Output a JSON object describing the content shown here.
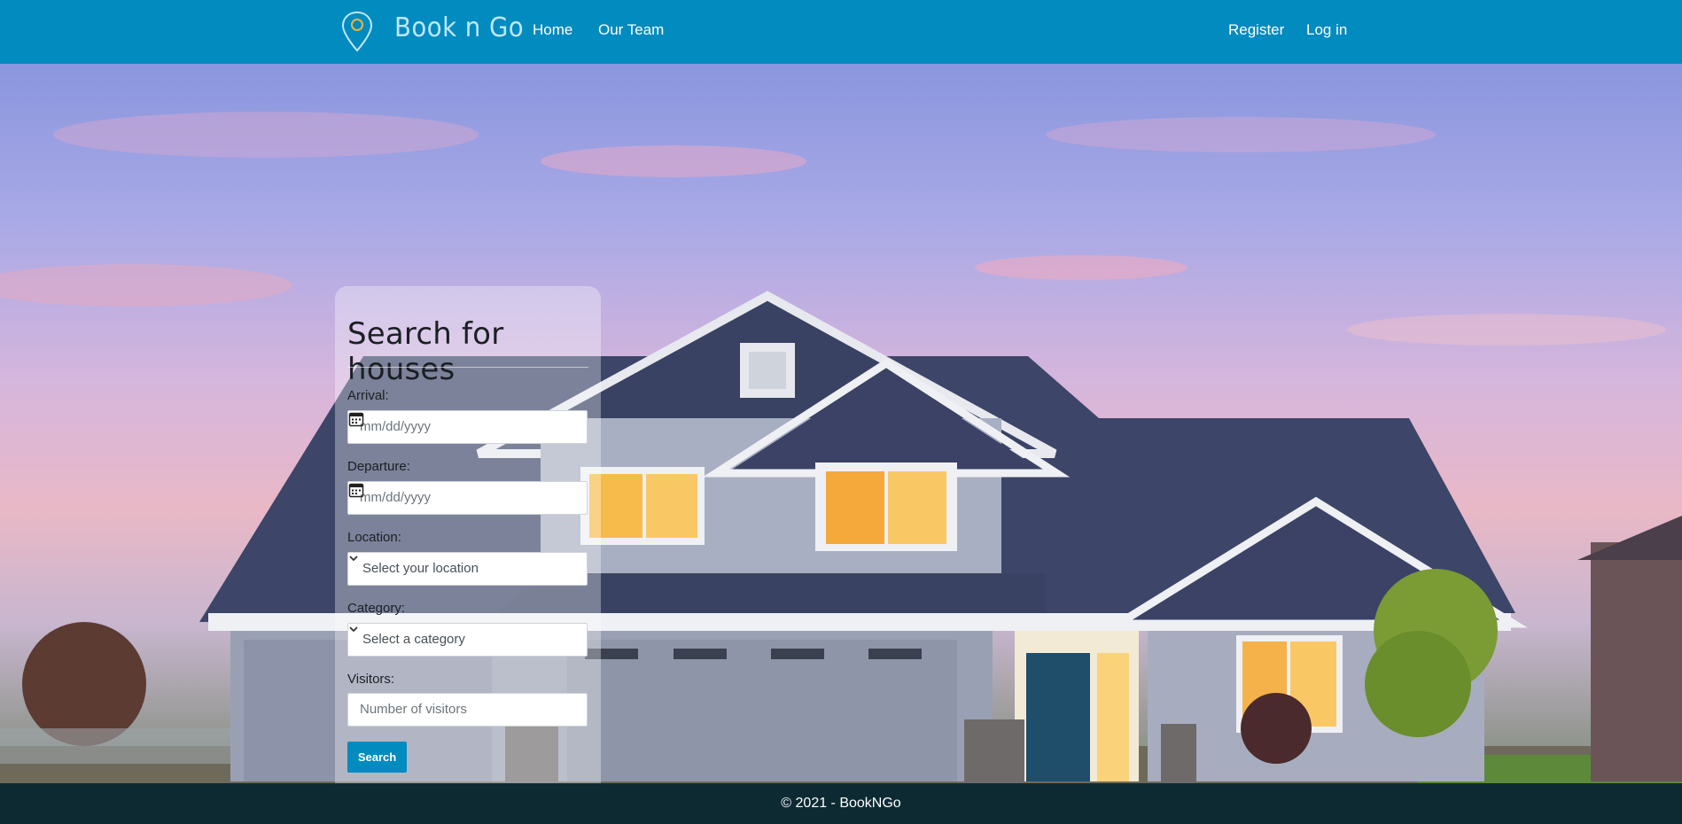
{
  "colors": {
    "brand": "#018bbf",
    "footer": "#0d2a33",
    "brand_text": "#bfe7f7"
  },
  "header": {
    "logo_icon": "map-pin-icon",
    "brand": "Book n Go",
    "nav": {
      "home": "Home",
      "team": "Our Team"
    },
    "auth": {
      "register": "Register",
      "login": "Log in"
    }
  },
  "hero": {
    "image": "house-at-dusk-photo"
  },
  "search": {
    "title": "Search for houses",
    "arrival_label": "Arrival:",
    "arrival_placeholder": "mm/dd/yyyy",
    "departure_label": "Departure:",
    "departure_placeholder": "mm/dd/yyyy",
    "location_label": "Location:",
    "location_selected": "Select your location",
    "category_label": "Category:",
    "category_selected": "Select a category",
    "visitors_label": "Visitors:",
    "visitors_placeholder": "Number of visitors",
    "button": "Search"
  },
  "footer": {
    "text": "© 2021 - BookNGo"
  }
}
